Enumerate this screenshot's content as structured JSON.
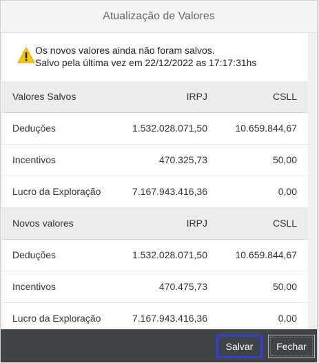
{
  "dialog": {
    "title": "Atualização de Valores"
  },
  "warning": {
    "icon": "warning-icon",
    "line1": "Os novos valores ainda não foram salvos.",
    "line2": "Salvo pela última vez em 22/12/2022 as 17:17:31hs"
  },
  "saved": {
    "header": {
      "label": "Valores Salvos",
      "irpj": "IRPJ",
      "csll": "CSLL"
    },
    "rows": [
      {
        "label": "Deduções",
        "irpj": "1.532.028.071,50",
        "csll": "10.659.844,67"
      },
      {
        "label": "Incentivos",
        "irpj": "470.325,73",
        "csll": "50,00"
      },
      {
        "label": "Lucro da Exploração",
        "irpj": "7.167.943.416,36",
        "csll": "0,00"
      }
    ]
  },
  "new": {
    "header": {
      "label": "Novos valores",
      "irpj": "IRPJ",
      "csll": "CSLL"
    },
    "rows": [
      {
        "label": "Deduções",
        "irpj": "1.532.028.071,50",
        "csll": "10.659.844,67"
      },
      {
        "label": "Incentivos",
        "irpj": "470.475,73",
        "csll": "50,00"
      },
      {
        "label": "Lucro da Exploração",
        "irpj": "7.167.943.416,36",
        "csll": "0,00"
      }
    ]
  },
  "footer": {
    "save_label": "Salvar",
    "close_label": "Fechar"
  },
  "colors": {
    "footer_bg": "#3f4447",
    "focus_outline": "#3b3fd0",
    "warning_yellow": "#f7c600"
  }
}
